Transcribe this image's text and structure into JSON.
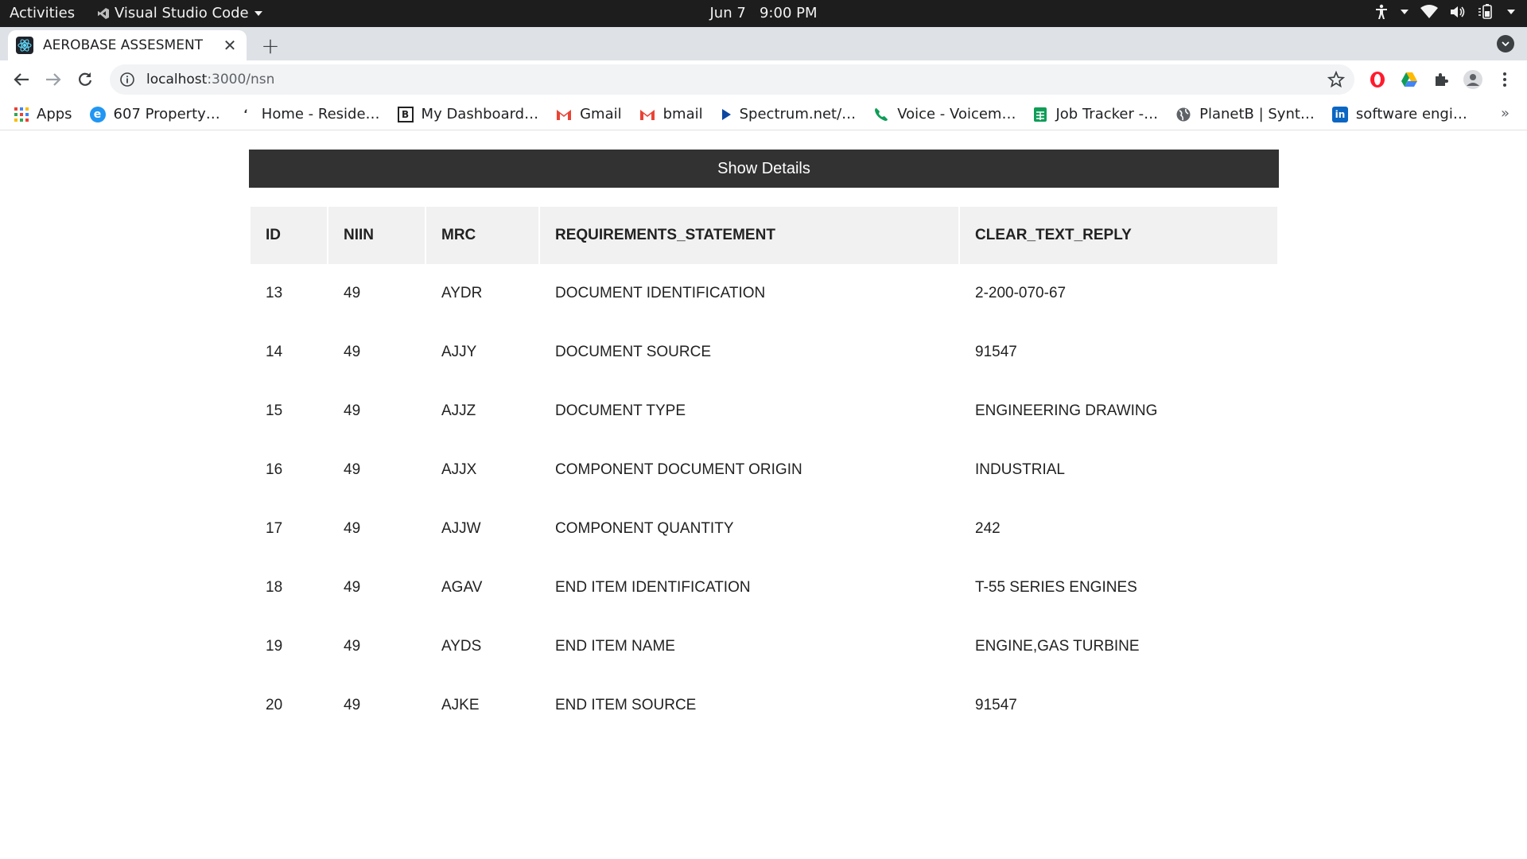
{
  "os": {
    "activities": "Activities",
    "app_name": "Visual Studio Code",
    "clock_date": "Jun 7",
    "clock_time": "9:00 PM"
  },
  "browser": {
    "tab_title": "AEROBASE ASSESMENT",
    "url_host": "localhost",
    "url_rest": ":3000/nsn",
    "bookmarks": [
      {
        "label": "Apps",
        "icon": "apps-grid-icon"
      },
      {
        "label": "607 Property…",
        "icon": "property-icon"
      },
      {
        "label": "Home - Reside…",
        "icon": "home-icon"
      },
      {
        "label": "My Dashboard…",
        "icon": "dashboard-icon"
      },
      {
        "label": "Gmail",
        "icon": "gmail-icon"
      },
      {
        "label": "bmail",
        "icon": "gmail-icon"
      },
      {
        "label": "Spectrum.net/…",
        "icon": "spectrum-icon"
      },
      {
        "label": "Voice - Voicem…",
        "icon": "voice-icon"
      },
      {
        "label": "Job Tracker -…",
        "icon": "sheets-icon"
      },
      {
        "label": "PlanetB | Synt…",
        "icon": "globe-icon"
      },
      {
        "label": "software engi…",
        "icon": "linkedin-icon"
      }
    ],
    "bookmarks_more": "»"
  },
  "page": {
    "show_details_label": "Show Details",
    "table": {
      "headers": [
        "ID",
        "NIIN",
        "MRC",
        "REQUIREMENTS_STATEMENT",
        "CLEAR_TEXT_REPLY"
      ],
      "rows": [
        [
          "13",
          "49",
          "AYDR",
          "DOCUMENT IDENTIFICATION",
          "2-200-070-67"
        ],
        [
          "14",
          "49",
          "AJJY",
          "DOCUMENT SOURCE",
          "91547"
        ],
        [
          "15",
          "49",
          "AJJZ",
          "DOCUMENT TYPE",
          "ENGINEERING DRAWING"
        ],
        [
          "16",
          "49",
          "AJJX",
          "COMPONENT DOCUMENT ORIGIN",
          "INDUSTRIAL"
        ],
        [
          "17",
          "49",
          "AJJW",
          "COMPONENT QUANTITY",
          "242"
        ],
        [
          "18",
          "49",
          "AGAV",
          "END ITEM IDENTIFICATION",
          "T-55 SERIES ENGINES"
        ],
        [
          "19",
          "49",
          "AYDS",
          "END ITEM NAME",
          "ENGINE,GAS TURBINE"
        ],
        [
          "20",
          "49",
          "AJKE",
          "END ITEM SOURCE",
          "91547"
        ]
      ]
    }
  },
  "colors": {
    "topbar": "#1d1d1d",
    "tabstrip": "#dee1e6",
    "show_details_bg": "#323232",
    "header_bg": "#f1f1f1"
  }
}
